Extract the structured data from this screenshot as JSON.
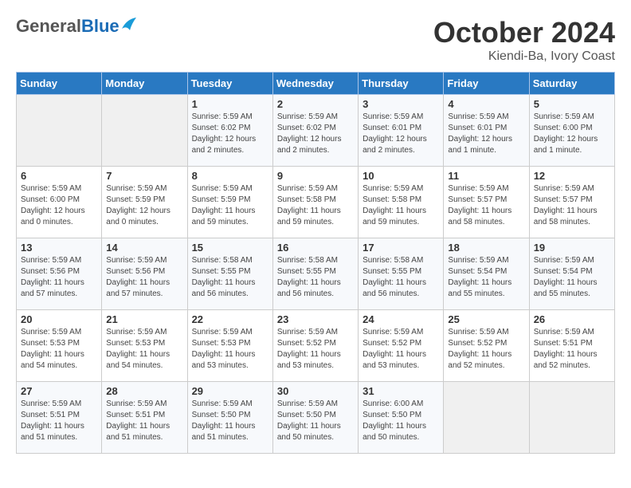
{
  "logo": {
    "general": "General",
    "blue": "Blue"
  },
  "header": {
    "month": "October 2024",
    "location": "Kiendi-Ba, Ivory Coast"
  },
  "weekdays": [
    "Sunday",
    "Monday",
    "Tuesday",
    "Wednesday",
    "Thursday",
    "Friday",
    "Saturday"
  ],
  "weeks": [
    [
      {
        "day": "",
        "info": ""
      },
      {
        "day": "",
        "info": ""
      },
      {
        "day": "1",
        "sunrise": "5:59 AM",
        "sunset": "6:02 PM",
        "daylight": "12 hours and 2 minutes."
      },
      {
        "day": "2",
        "sunrise": "5:59 AM",
        "sunset": "6:02 PM",
        "daylight": "12 hours and 2 minutes."
      },
      {
        "day": "3",
        "sunrise": "5:59 AM",
        "sunset": "6:01 PM",
        "daylight": "12 hours and 2 minutes."
      },
      {
        "day": "4",
        "sunrise": "5:59 AM",
        "sunset": "6:01 PM",
        "daylight": "12 hours and 1 minute."
      },
      {
        "day": "5",
        "sunrise": "5:59 AM",
        "sunset": "6:00 PM",
        "daylight": "12 hours and 1 minute."
      }
    ],
    [
      {
        "day": "6",
        "sunrise": "5:59 AM",
        "sunset": "6:00 PM",
        "daylight": "12 hours and 0 minutes."
      },
      {
        "day": "7",
        "sunrise": "5:59 AM",
        "sunset": "5:59 PM",
        "daylight": "12 hours and 0 minutes."
      },
      {
        "day": "8",
        "sunrise": "5:59 AM",
        "sunset": "5:59 PM",
        "daylight": "11 hours and 59 minutes."
      },
      {
        "day": "9",
        "sunrise": "5:59 AM",
        "sunset": "5:58 PM",
        "daylight": "11 hours and 59 minutes."
      },
      {
        "day": "10",
        "sunrise": "5:59 AM",
        "sunset": "5:58 PM",
        "daylight": "11 hours and 59 minutes."
      },
      {
        "day": "11",
        "sunrise": "5:59 AM",
        "sunset": "5:57 PM",
        "daylight": "11 hours and 58 minutes."
      },
      {
        "day": "12",
        "sunrise": "5:59 AM",
        "sunset": "5:57 PM",
        "daylight": "11 hours and 58 minutes."
      }
    ],
    [
      {
        "day": "13",
        "sunrise": "5:59 AM",
        "sunset": "5:56 PM",
        "daylight": "11 hours and 57 minutes."
      },
      {
        "day": "14",
        "sunrise": "5:59 AM",
        "sunset": "5:56 PM",
        "daylight": "11 hours and 57 minutes."
      },
      {
        "day": "15",
        "sunrise": "5:58 AM",
        "sunset": "5:55 PM",
        "daylight": "11 hours and 56 minutes."
      },
      {
        "day": "16",
        "sunrise": "5:58 AM",
        "sunset": "5:55 PM",
        "daylight": "11 hours and 56 minutes."
      },
      {
        "day": "17",
        "sunrise": "5:58 AM",
        "sunset": "5:55 PM",
        "daylight": "11 hours and 56 minutes."
      },
      {
        "day": "18",
        "sunrise": "5:59 AM",
        "sunset": "5:54 PM",
        "daylight": "11 hours and 55 minutes."
      },
      {
        "day": "19",
        "sunrise": "5:59 AM",
        "sunset": "5:54 PM",
        "daylight": "11 hours and 55 minutes."
      }
    ],
    [
      {
        "day": "20",
        "sunrise": "5:59 AM",
        "sunset": "5:53 PM",
        "daylight": "11 hours and 54 minutes."
      },
      {
        "day": "21",
        "sunrise": "5:59 AM",
        "sunset": "5:53 PM",
        "daylight": "11 hours and 54 minutes."
      },
      {
        "day": "22",
        "sunrise": "5:59 AM",
        "sunset": "5:53 PM",
        "daylight": "11 hours and 53 minutes."
      },
      {
        "day": "23",
        "sunrise": "5:59 AM",
        "sunset": "5:52 PM",
        "daylight": "11 hours and 53 minutes."
      },
      {
        "day": "24",
        "sunrise": "5:59 AM",
        "sunset": "5:52 PM",
        "daylight": "11 hours and 53 minutes."
      },
      {
        "day": "25",
        "sunrise": "5:59 AM",
        "sunset": "5:52 PM",
        "daylight": "11 hours and 52 minutes."
      },
      {
        "day": "26",
        "sunrise": "5:59 AM",
        "sunset": "5:51 PM",
        "daylight": "11 hours and 52 minutes."
      }
    ],
    [
      {
        "day": "27",
        "sunrise": "5:59 AM",
        "sunset": "5:51 PM",
        "daylight": "11 hours and 51 minutes."
      },
      {
        "day": "28",
        "sunrise": "5:59 AM",
        "sunset": "5:51 PM",
        "daylight": "11 hours and 51 minutes."
      },
      {
        "day": "29",
        "sunrise": "5:59 AM",
        "sunset": "5:50 PM",
        "daylight": "11 hours and 51 minutes."
      },
      {
        "day": "30",
        "sunrise": "5:59 AM",
        "sunset": "5:50 PM",
        "daylight": "11 hours and 50 minutes."
      },
      {
        "day": "31",
        "sunrise": "6:00 AM",
        "sunset": "5:50 PM",
        "daylight": "11 hours and 50 minutes."
      },
      {
        "day": "",
        "info": ""
      },
      {
        "day": "",
        "info": ""
      }
    ]
  ]
}
